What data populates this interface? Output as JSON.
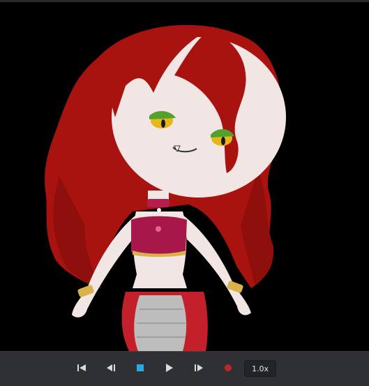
{
  "viewer": {
    "background_color": "#000000",
    "accent_color": "#27a9e1",
    "record_color": "#c0242b"
  },
  "playback": {
    "buttons": [
      {
        "icon": "skip-to-start-icon"
      },
      {
        "icon": "step-back-icon"
      },
      {
        "icon": "stop-icon"
      },
      {
        "icon": "play-icon"
      },
      {
        "icon": "step-forward-icon"
      },
      {
        "icon": "record-icon"
      }
    ],
    "speed_label": "1.0x"
  }
}
